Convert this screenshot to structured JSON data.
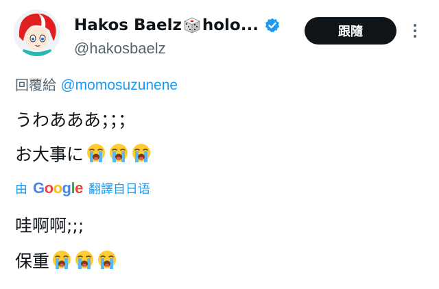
{
  "tweet": {
    "display_name": "Hakos Baelz",
    "display_name_suffix": "holo...",
    "handle": "@hakosbaelz",
    "follow_label": "跟隨",
    "reply_prefix": "回覆給",
    "reply_mention": "@momosuzunene",
    "original_lines": [
      "うわあああ；；；",
      "お大事に"
    ],
    "translation": {
      "by": "由",
      "provider_letters": [
        "G",
        "o",
        "o",
        "g",
        "l",
        "e"
      ],
      "provider_colors": [
        "#4285F4",
        "#EA4335",
        "#FBBC05",
        "#4285F4",
        "#34A853",
        "#EA4335"
      ],
      "suffix": "翻譯自日语"
    },
    "translated_lines": [
      "哇啊啊;;;",
      "保重"
    ]
  },
  "icons": {
    "avatar": "avatar-icon",
    "dice": "dice-icon",
    "verified": "verified-badge-icon",
    "more": "more-vertical-icon",
    "emoji": "loudly-crying-face-emoji"
  },
  "colors": {
    "text": "#0f1419",
    "secondary": "#536471",
    "link": "#1d9bf0",
    "button_bg": "#0f1419",
    "verified": "#1d9bf0"
  }
}
